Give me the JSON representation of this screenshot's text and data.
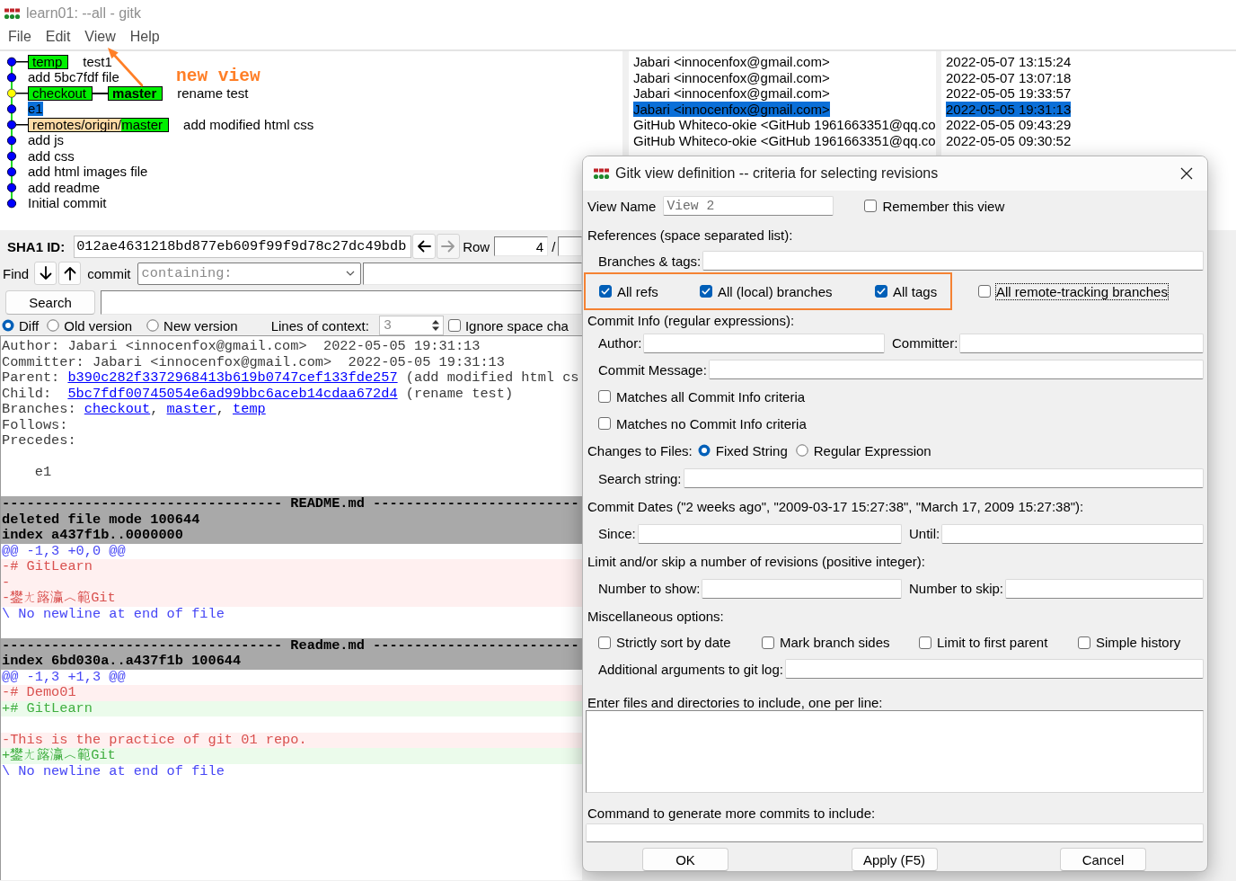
{
  "window": {
    "title": "learn01: --all - gitk"
  },
  "menu": [
    {
      "label": "File"
    },
    {
      "label": "Edit"
    },
    {
      "label": "View"
    },
    {
      "label": "Help"
    }
  ],
  "annotation": {
    "text": "new view"
  },
  "commits": [
    {
      "refs": [
        {
          "kind": "local",
          "name": "temp",
          "current": false
        }
      ],
      "message": "test1",
      "author": "Jabari <innocenfox@gmail.com>",
      "date": "2022-05-07 13:15:24",
      "head": false,
      "selected": false
    },
    {
      "message": "add 5bc7fdf file",
      "author": "Jabari <innocenfox@gmail.com>",
      "date": "2022-05-07 13:07:18",
      "head": false,
      "selected": false
    },
    {
      "refs": [
        {
          "kind": "local",
          "name": "checkout",
          "current": false
        },
        {
          "kind": "local",
          "name": "master",
          "current": true
        }
      ],
      "message": "rename test",
      "author": "Jabari <innocenfox@gmail.com>",
      "date": "2022-05-05 19:33:57",
      "head": true,
      "selected": false
    },
    {
      "message": "e1",
      "author": "Jabari <innocenfox@gmail.com>",
      "date": "2022-05-05 19:31:13",
      "head": false,
      "selected": true
    },
    {
      "refs": [
        {
          "kind": "remote",
          "remote": "remotes/origin/",
          "name": "master",
          "current": false
        }
      ],
      "message": "add modified html css",
      "author": "GitHub Whiteco-okie <GitHub 1961663351@qq.co",
      "date": "2022-05-05 09:43:29",
      "head": false,
      "selected": false
    },
    {
      "message": "add js",
      "author": "GitHub Whiteco-okie <GitHub 1961663351@qq.co",
      "date": "2022-05-05 09:30:52",
      "head": false,
      "selected": false
    },
    {
      "message": "add css",
      "head": false,
      "selected": false
    },
    {
      "message": "add html images file",
      "head": false,
      "selected": false
    },
    {
      "message": "add readme",
      "head": false,
      "selected": false
    },
    {
      "message": "Initial commit",
      "head": false,
      "selected": false
    }
  ],
  "sha_row": {
    "label": "SHA1 ID:",
    "sha": "012ae4631218bd877eb609f99f9d78c27dc49bdb",
    "back": {
      "disabled": false
    },
    "forward": {
      "disabled": true
    },
    "row_label": "Row",
    "row": "4",
    "row_separator": "/"
  },
  "find_row": {
    "label": "Find",
    "scope": "commit",
    "mode": "containing:"
  },
  "search": {
    "button": "Search"
  },
  "diff_options": {
    "modes": [
      {
        "label": "Diff",
        "selected": true
      },
      {
        "label": "Old version",
        "selected": false
      },
      {
        "label": "New version",
        "selected": false
      }
    ],
    "context_label": "Lines of context:",
    "context": "3",
    "ignore_space": {
      "label": "Ignore space cha",
      "checked": false
    }
  },
  "commit_info": {
    "author": "Author: Jabari <innocenfox@gmail.com>  2022-05-05 19:31:13",
    "committer": "Committer: Jabari <innocenfox@gmail.com>  2022-05-05 19:31:13",
    "relations": [
      {
        "label": "Parent:",
        "hash": "b390c282f3372968413b619b0747cef133fde257",
        "summary": "(add modified html cs"
      },
      {
        "label": "Child:",
        "hash": "5bc7fdf00745054e6ad99bbc6aceb14cdaa672d4",
        "summary": "(rename test)"
      }
    ],
    "branches": {
      "label": "Branches:",
      "separator": ",",
      "links": [
        "checkout",
        "master",
        "temp"
      ]
    },
    "follows": "Follows:",
    "precedes": "Precedes:",
    "message": "e1"
  },
  "diff": [
    {
      "kind": "blank"
    },
    {
      "kind": "file_header",
      "text": "---------------------------------- README.md -------------------------"
    },
    {
      "kind": "meta",
      "text": "deleted file mode 100644"
    },
    {
      "kind": "meta",
      "text": "index a437f1b..0000000"
    },
    {
      "kind": "hunk",
      "text": "@@ -1,3 +0,0 @@"
    },
    {
      "kind": "del",
      "text": "-# GitLearn"
    },
    {
      "kind": "del",
      "text": "-"
    },
    {
      "kind": "del",
      "text": "-鐢ㄤ簬瀛︿範Git"
    },
    {
      "kind": "note",
      "text": "\\ No newline at end of file"
    },
    {
      "kind": "blank"
    },
    {
      "kind": "file_header",
      "text": "---------------------------------- Readme.md -------------------------"
    },
    {
      "kind": "meta",
      "text": "index 6bd030a..a437f1b 100644"
    },
    {
      "kind": "hunk",
      "text": "@@ -1,3 +1,3 @@"
    },
    {
      "kind": "del",
      "text": "-# Demo01"
    },
    {
      "kind": "add",
      "text": "+# GitLearn"
    },
    {
      "kind": "blank"
    },
    {
      "kind": "del",
      "text": "-This is the practice of git 01 repo."
    },
    {
      "kind": "add",
      "text": "+鐢ㄤ簬瀛︿範Git"
    },
    {
      "kind": "note",
      "text": "\\ No newline at end of file"
    }
  ],
  "dialog": {
    "title": "Gitk view definition -- criteria for selecting revisions",
    "view_name": {
      "label": "View Name",
      "value": "View 2"
    },
    "remember": {
      "label": "Remember this view",
      "checked": false
    },
    "references": {
      "heading": "References (space separated list):",
      "field_label": "Branches & tags:",
      "options": [
        {
          "label": "All refs",
          "checked": true,
          "highlighted": true,
          "focused": false
        },
        {
          "label": "All (local) branches",
          "checked": true,
          "highlighted": true,
          "focused": false
        },
        {
          "label": "All tags",
          "checked": true,
          "highlighted": true,
          "focused": false
        },
        {
          "label": "All remote-tracking branches",
          "checked": false,
          "highlighted": false,
          "focused": true
        }
      ]
    },
    "commit_info": {
      "heading": "Commit Info (regular expressions):",
      "author_label": "Author:",
      "committer_label": "Committer:",
      "message_label": "Commit Message:",
      "options": [
        {
          "label": "Matches all Commit Info criteria",
          "checked": false
        },
        {
          "label": "Matches no Commit Info criteria",
          "checked": false
        }
      ]
    },
    "files": {
      "label": "Changes to Files:",
      "modes": [
        {
          "label": "Fixed String",
          "selected": true
        },
        {
          "label": "Regular Expression",
          "selected": false
        }
      ],
      "search_label": "Search string:"
    },
    "dates": {
      "heading": "Commit Dates (\"2 weeks ago\", \"2009-03-17 15:27:38\", \"March 17, 2009 15:27:38\"):",
      "since_label": "Since:",
      "until_label": "Until:"
    },
    "limit": {
      "heading": "Limit and/or skip a number of revisions (positive integer):",
      "show_label": "Number to show:",
      "skip_label": "Number to skip:"
    },
    "misc": {
      "heading": "Miscellaneous options:",
      "options": [
        {
          "label": "Strictly sort by date",
          "checked": false
        },
        {
          "label": "Mark branch sides",
          "checked": false
        },
        {
          "label": "Limit to first parent",
          "checked": false
        },
        {
          "label": "Simple history",
          "checked": false
        }
      ],
      "args_label": "Additional arguments to git log:"
    },
    "paths_heading": "Enter files and directories to include, one per line:",
    "command_heading": "Command to generate more commits to include:",
    "buttons": [
      {
        "label": "OK"
      },
      {
        "label": "Apply (F5)"
      },
      {
        "label": "Cancel"
      }
    ]
  }
}
